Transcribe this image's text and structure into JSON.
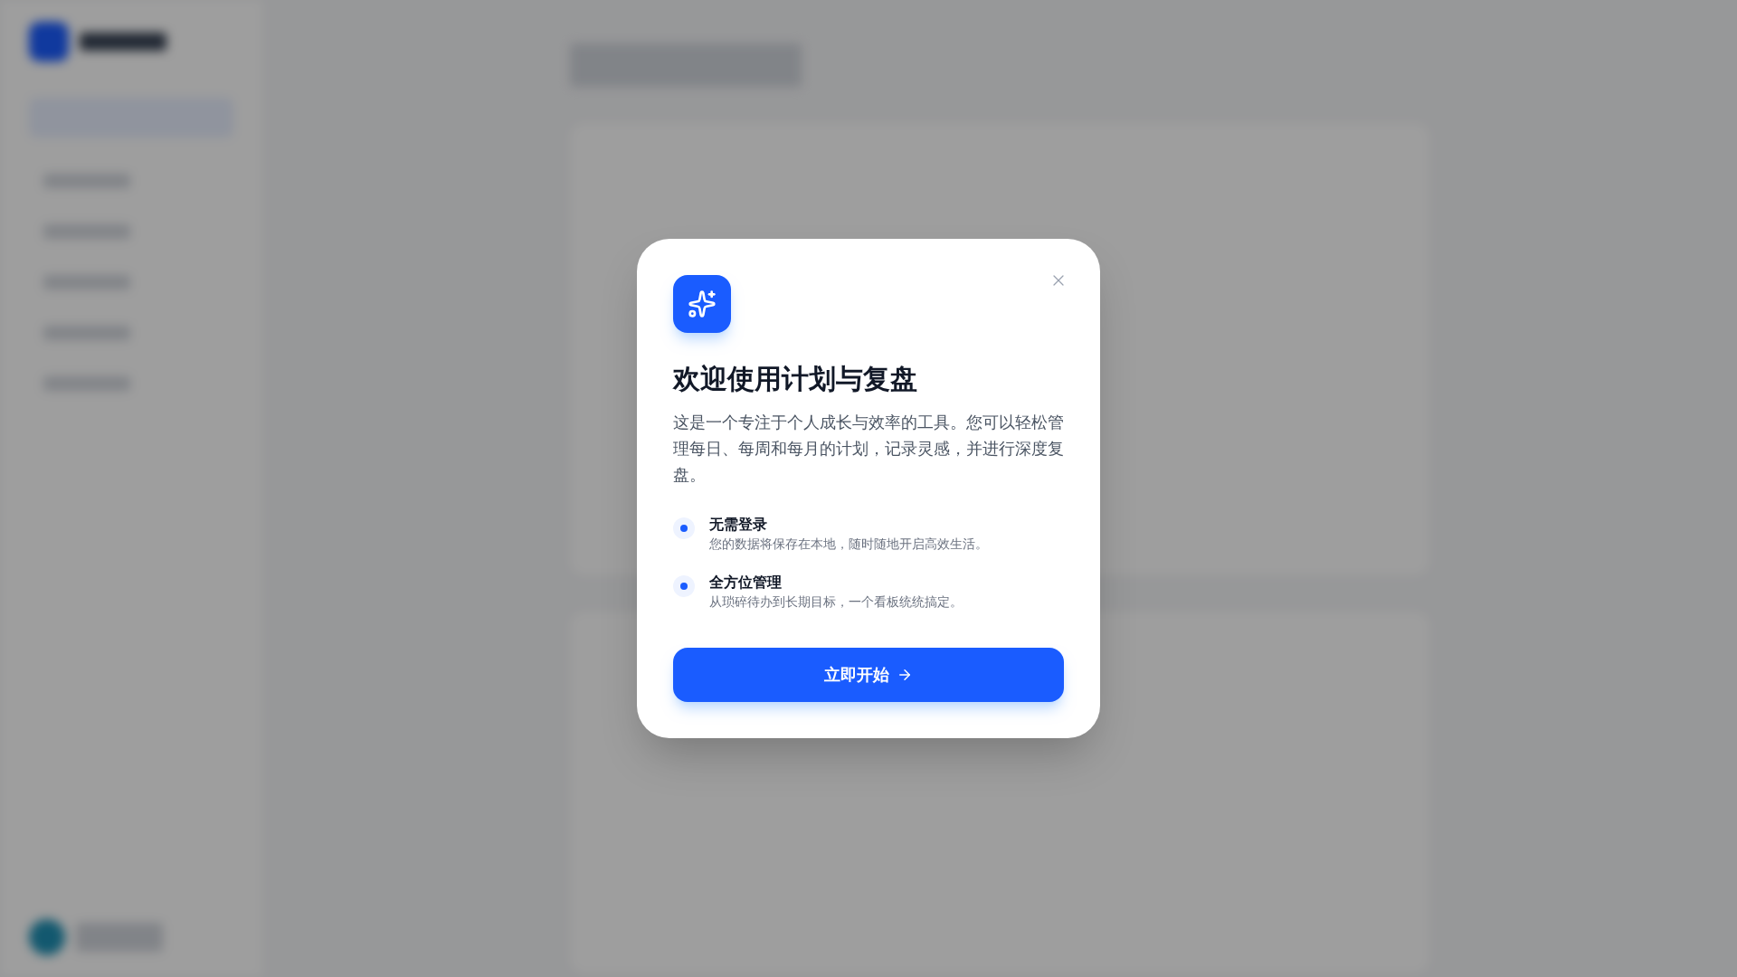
{
  "dialog": {
    "title": "欢迎使用计划与复盘",
    "description": "这是一个专注于个人成长与效率的工具。您可以轻松管理每日、每周和每月的计划，记录灵感，并进行深度复盘。",
    "features": [
      {
        "title": "无需登录",
        "text": "您的数据将保存在本地，随时随地开启高效生活。"
      },
      {
        "title": "全方位管理",
        "text": "从琐碎待办到长期目标，一个看板统统搞定。"
      }
    ],
    "primary_button": "立即开始"
  }
}
